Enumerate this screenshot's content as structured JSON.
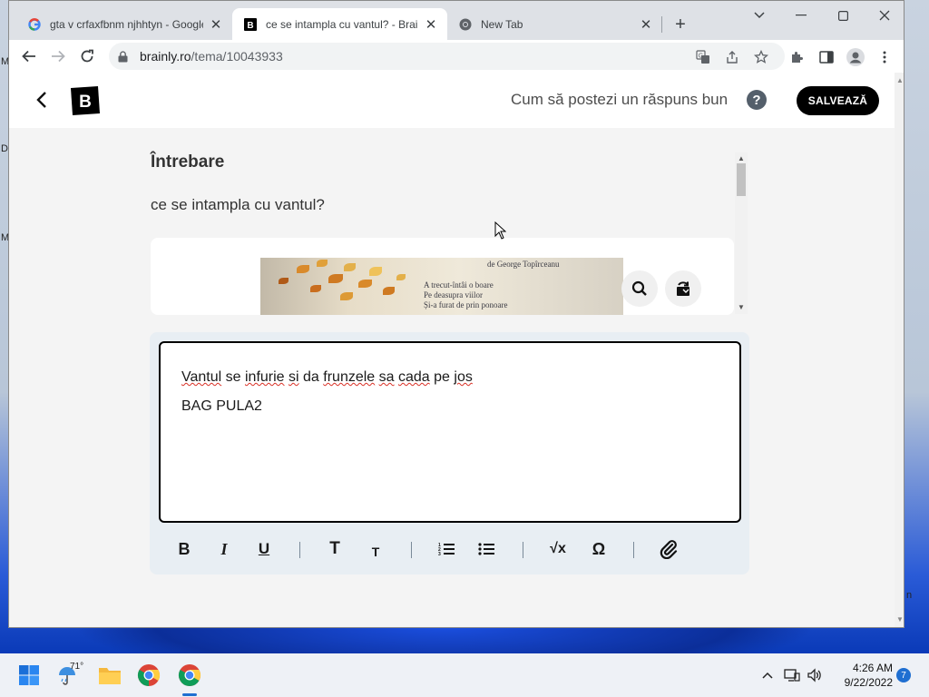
{
  "desktop": {
    "edge_letters": [
      "M",
      "D",
      "M",
      "n"
    ]
  },
  "browser": {
    "tabs": [
      {
        "title": "gta v crfaxfbnm njhhtyn - Google",
        "favicon": "google-g-icon",
        "active": false
      },
      {
        "title": "ce se intampla cu vantul? - Brain",
        "favicon": "brainly-icon",
        "active": true
      },
      {
        "title": "New Tab",
        "favicon": "chrome-icon",
        "active": false
      }
    ],
    "new_tab_glyph": "+",
    "address": {
      "host": "brainly.ro",
      "path": "/tema/10043933"
    }
  },
  "brainly": {
    "how_to_label": "Cum să postezi un răspuns bun",
    "help_glyph": "?",
    "save_label": "SALVEAZĂ",
    "logo_letter": "B",
    "question": {
      "heading": "Întrebare",
      "text": "ce se intampla cu vantul?",
      "image_lines": [
        "de George Topîrceanu",
        "A trecut-întâi o boare",
        "Pe deasupra viilor",
        "Și-a furat de prin ponoare"
      ]
    },
    "answer": {
      "line1_parts": [
        "Vantul",
        " se ",
        "infurie",
        " ",
        "si",
        " da ",
        "frunzele",
        " ",
        "sa",
        " ",
        "cada",
        " pe ",
        "jos"
      ],
      "line2": "BAG PULA2"
    },
    "format_toolbar": {
      "bold": "B",
      "italic": "I",
      "underline": "U",
      "heading_large": "T",
      "heading_small": "T",
      "math_symbol": "√x",
      "omega_symbol": "Ω"
    }
  },
  "taskbar": {
    "weather_temp": "71°",
    "time": "4:26 AM",
    "date": "9/22/2022",
    "notification_count": "7"
  }
}
